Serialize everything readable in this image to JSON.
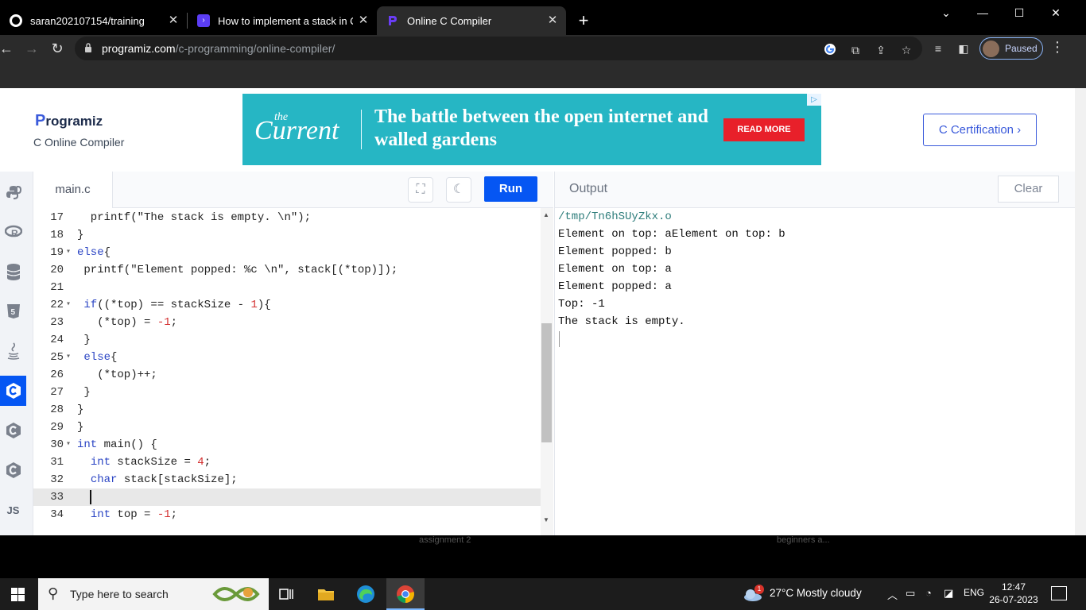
{
  "browser": {
    "tabs": [
      {
        "title": "saran202107154/training",
        "active": false,
        "icon": "github-icon"
      },
      {
        "title": "How to implement a stack in C u",
        "active": false,
        "icon": "programiz-terminal-icon"
      },
      {
        "title": "Online C Compiler",
        "active": true,
        "icon": "programiz-icon"
      }
    ],
    "url_host": "programiz.com",
    "url_path": "/c-programming/online-compiler/",
    "profile_label": "Paused"
  },
  "site": {
    "logo_text": "rogramiz",
    "logo_letter": "P",
    "subtitle": "C Online Compiler",
    "cert_button": "C Certification ›"
  },
  "ad": {
    "brand_the": "the",
    "brand": "Current",
    "headline": "The battle between the open internet and walled gardens",
    "button": "READ MORE"
  },
  "sidebar_langs": [
    {
      "name": "python",
      "icon": "python-icon"
    },
    {
      "name": "r",
      "icon": "r-icon"
    },
    {
      "name": "sql",
      "icon": "database-icon"
    },
    {
      "name": "html",
      "icon": "html5-icon"
    },
    {
      "name": "java",
      "icon": "java-icon"
    },
    {
      "name": "c",
      "icon": "c-icon",
      "active": true
    },
    {
      "name": "cpp",
      "icon": "cpp-icon"
    },
    {
      "name": "csharp",
      "icon": "csharp-icon"
    },
    {
      "name": "js",
      "label": "JS",
      "icon": "js-icon"
    }
  ],
  "editor": {
    "file_tab": "main.c",
    "run_label": "Run",
    "lines": [
      {
        "n": "17",
        "fold": false,
        "text": "  printf(\"The stack is empty. \\n\");"
      },
      {
        "n": "18",
        "fold": false,
        "text": "}"
      },
      {
        "n": "19",
        "fold": true,
        "text": "else{"
      },
      {
        "n": "20",
        "fold": false,
        "text": " printf(\"Element popped: %c \\n\", stack[(*top)]);"
      },
      {
        "n": "21",
        "fold": false,
        "text": ""
      },
      {
        "n": "22",
        "fold": true,
        "text": " if((*top) == stackSize - 1){"
      },
      {
        "n": "23",
        "fold": false,
        "text": "   (*top) = -1;"
      },
      {
        "n": "24",
        "fold": false,
        "text": " }"
      },
      {
        "n": "25",
        "fold": true,
        "text": " else{"
      },
      {
        "n": "26",
        "fold": false,
        "text": "   (*top)++;"
      },
      {
        "n": "27",
        "fold": false,
        "text": " }"
      },
      {
        "n": "28",
        "fold": false,
        "text": "}"
      },
      {
        "n": "29",
        "fold": false,
        "text": "}"
      },
      {
        "n": "30",
        "fold": true,
        "text": "int main() {"
      },
      {
        "n": "31",
        "fold": false,
        "text": "  int stackSize = 4;"
      },
      {
        "n": "32",
        "fold": false,
        "text": "  char stack[stackSize];"
      },
      {
        "n": "33",
        "fold": false,
        "text": "",
        "current": true
      },
      {
        "n": "34",
        "fold": false,
        "text": "  int top = -1;"
      }
    ]
  },
  "output": {
    "title": "Output",
    "clear_label": "Clear",
    "lines": [
      "/tmp/Tn6hSUyZkx.o",
      "Element on top: aElement on top: b",
      "Element popped: b",
      "Element on top: a",
      "Element popped: a",
      "Top: -1",
      "The stack is empty."
    ]
  },
  "below_page": {
    "left_text": "assignment 2",
    "right_text": "beginners a..."
  },
  "taskbar": {
    "search_placeholder": "Type here to search",
    "weather_badge": "1",
    "weather": "27°C  Mostly cloudy",
    "lang": "ENG",
    "time": "12:47",
    "date": "26-07-2023"
  },
  "colors": {
    "accent": "#0556f3",
    "ad_bg": "#26b6c4",
    "ad_button": "#e8202a"
  }
}
